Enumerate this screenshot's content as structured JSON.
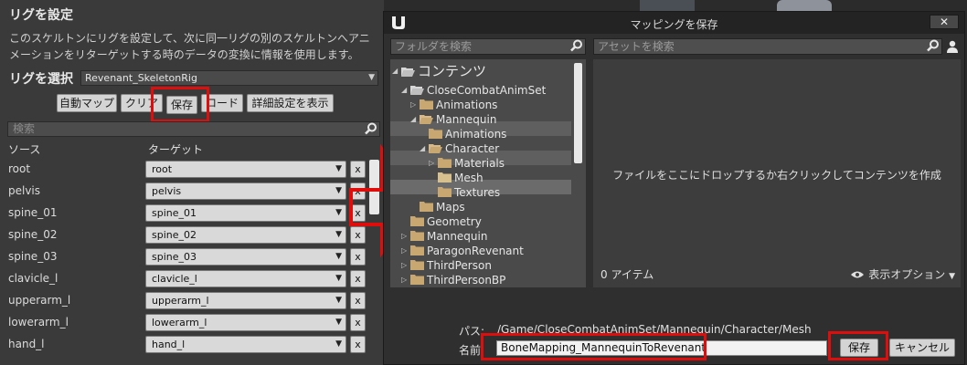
{
  "left_panel": {
    "title": "リグを設定",
    "description": "このスケルトンにリグを設定して、次に同一リグの別のスケルトンへアニメーションをリターゲットする時のデータの変換に情報を使用します。",
    "rig_label": "リグを選択",
    "rig_value": "Revenant_SkeletonRig",
    "buttons": {
      "auto_map": "自動マップ",
      "clear": "クリア",
      "save": "保存",
      "load": "ロード",
      "advanced": "詳細設定を表示"
    },
    "search_placeholder": "検索",
    "col_source": "ソース",
    "col_target": "ターゲット",
    "remove_label": "x",
    "rows": [
      {
        "source": "root",
        "target": "root"
      },
      {
        "source": "pelvis",
        "target": "pelvis"
      },
      {
        "source": "spine_01",
        "target": "spine_01"
      },
      {
        "source": "spine_02",
        "target": "spine_02"
      },
      {
        "source": "spine_03",
        "target": "spine_03"
      },
      {
        "source": "clavicle_l",
        "target": "clavicle_l"
      },
      {
        "source": "upperarm_l",
        "target": "upperarm_l"
      },
      {
        "source": "lowerarm_l",
        "target": "lowerarm_l"
      },
      {
        "source": "hand_l",
        "target": "hand_l"
      }
    ]
  },
  "dialog": {
    "title": "マッピングを保存",
    "close_label": "✕",
    "folder_search_placeholder": "フォルダを検索",
    "asset_search_placeholder": "アセットを検索",
    "tree": {
      "content": "コンテンツ",
      "close_combat": "CloseCombatAnimSet",
      "animations_1": "Animations",
      "mannequin_1": "Mannequin",
      "animations_2": "Animations",
      "character": "Character",
      "materials": "Materials",
      "mesh": "Mesh",
      "textures": "Textures",
      "maps": "Maps",
      "geometry": "Geometry",
      "mannequin_2": "Mannequin",
      "paragon": "ParagonRevenant",
      "third_person": "ThirdPerson",
      "third_person_bp": "ThirdPersonBP"
    },
    "drop_hint": "ファイルをここにドロップするか右クリックしてコンテンツを作成",
    "item_count": "0 アイテム",
    "view_options": "表示オプション",
    "path_label": "パス:",
    "path_value": "/Game/CloseCombatAnimSet/Mannequin/Character/Mesh",
    "name_label": "名前:",
    "name_value": "BoneMapping_MannequinToRevenant",
    "save_label": "保存",
    "cancel_label": "キャンセル"
  },
  "colors": {
    "highlight": "#e00d0d",
    "folder": "#c8a870"
  }
}
